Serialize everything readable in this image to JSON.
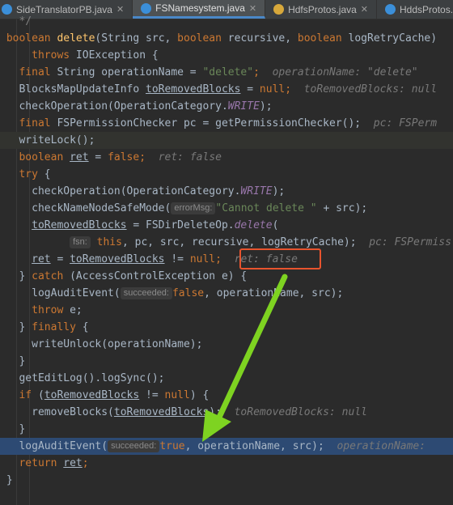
{
  "tabs": [
    {
      "label": "SideTranslatorPB.java",
      "icon": "class-icon",
      "active": false
    },
    {
      "label": "FSNamesystem.java",
      "icon": "class-icon",
      "active": true
    },
    {
      "label": "HdfsProtos.java",
      "icon": "interface-icon",
      "active": false
    },
    {
      "label": "HddsProtos.class",
      "icon": "class-icon",
      "active": false
    }
  ],
  "code": {
    "l01": "*/",
    "l02_kw1": "boolean",
    "l02_fn": "delete",
    "l02_p1": "(String src, ",
    "l02_kw2": "boolean",
    "l02_p2": " recursive, ",
    "l02_kw3": "boolean",
    "l02_p3": " logRetryCache)",
    "l03_kw": "throws",
    "l03_rest": " IOException {",
    "l04_kw": "final",
    "l04_a": " String operationName = ",
    "l04_str": "\"delete\"",
    "l04_semi": ";",
    "l04_hint": "operationName: \"delete\"",
    "l05_a": "BlocksMapUpdateInfo ",
    "l05_var": "toRemovedBlocks",
    "l05_b": " = ",
    "l05_kw": "null",
    "l05_semi": ";",
    "l05_hint": "toRemovedBlocks: null",
    "l06_a": "checkOperation(OperationCategory.",
    "l06_c": "WRITE",
    "l06_b": ");",
    "l07_kw": "final",
    "l07_a": " FSPermissionChecker pc = getPermissionChecker();",
    "l07_hint": "pc: FSPerm",
    "l08": "writeLock();",
    "l09_kw": "boolean",
    "l09_var": "ret",
    "l09_b": " = ",
    "l09_kw2": "false",
    "l09_semi": ";",
    "l09_hint": "ret: false",
    "l10_kw": "try",
    "l10_b": " {",
    "l11_a": "checkOperation(OperationCategory.",
    "l11_c": "WRITE",
    "l11_b": ");",
    "l12_a": "checkNameNodeSafeMode(",
    "l12_ph": "errorMsg:",
    "l12_str": "\"Cannot delete \"",
    "l12_b": " + src);",
    "l13_var": "toRemovedBlocks",
    "l13_a": " = FSDirDeleteOp.",
    "l13_m": "delete",
    "l13_b": "(",
    "l14_ph": "fsn:",
    "l14_kw": "this",
    "l14_a": ", pc, src, recursive, logRetryCache);",
    "l14_hint": "pc: FSPermiss",
    "l15_var": "ret",
    "l15_a": " = ",
    "l15_var2": "toRemovedBlocks",
    "l15_b": " != ",
    "l15_kw": "null",
    "l15_semi": ";",
    "l15_hint": "ret: false",
    "l16_a": "} ",
    "l16_kw": "catch",
    "l16_b": " (AccessControlException e) {",
    "l17_a": "logAuditEvent(",
    "l17_ph": "succeeded:",
    "l17_kw": "false",
    "l17_b": ", operationName, src);",
    "l18_kw": "throw",
    "l18_b": " e;",
    "l19_a": "} ",
    "l19_kw": "finally",
    "l19_b": " {",
    "l20": "writeUnlock(operationName);",
    "l21": "}",
    "l22": "getEditLog().logSync();",
    "l23_kw": "if",
    "l23_a": " (",
    "l23_var": "toRemovedBlocks",
    "l23_b": " != ",
    "l23_kw2": "null",
    "l23_c": ") {",
    "l24_a": "removeBlocks(",
    "l24_var": "toRemovedBlocks",
    "l24_b": ");",
    "l24_hint": "toRemovedBlocks: null",
    "l25": "}",
    "l26_a": "logAuditEvent(",
    "l26_ph": "succeeded:",
    "l26_kw": "true",
    "l26_b": ", operationName, src);",
    "l26_hint": "operationName:",
    "l27_kw": "return",
    "l27_var": "ret",
    "l27_semi": ";",
    "l28": "}"
  },
  "colors": {
    "editor_bg": "#2b2b2b",
    "keyword": "#cc7832",
    "string": "#6a8759",
    "constant": "#9876aa",
    "execution_line": "#2d4a73",
    "annotation_box": "#e8542e",
    "annotation_arrow": "#7ed321"
  }
}
